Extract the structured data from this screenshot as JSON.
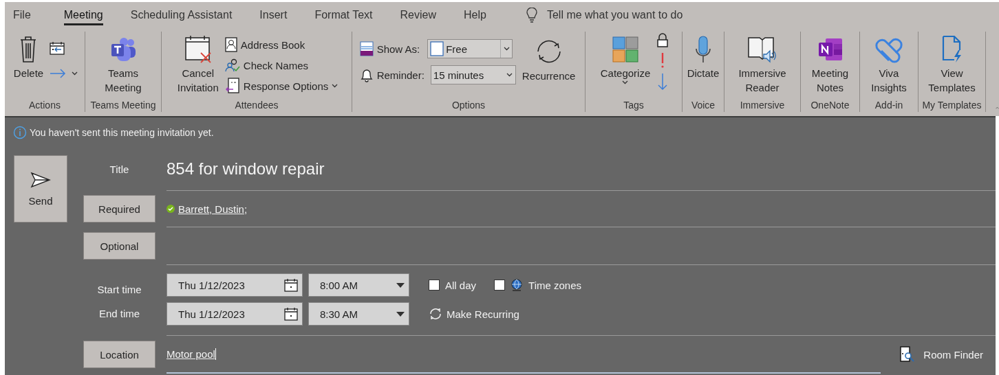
{
  "menu_tabs": [
    {
      "label": "File",
      "selected": false
    },
    {
      "label": "Meeting",
      "selected": true
    },
    {
      "label": "Scheduling Assistant",
      "selected": false
    },
    {
      "label": "Insert",
      "selected": false
    },
    {
      "label": "Format Text",
      "selected": false
    },
    {
      "label": "Review",
      "selected": false
    },
    {
      "label": "Help",
      "selected": false
    }
  ],
  "tell_me": {
    "placeholder": "Tell me what you want to do"
  },
  "ribbon_groups": [
    {
      "label": "Actions",
      "buttons": [
        {
          "label": "Delete"
        }
      ]
    },
    {
      "label": "Teams Meeting",
      "buttons": [
        {
          "label": "Teams Meeting"
        }
      ]
    },
    {
      "label": "Attendees",
      "buttons": [
        {
          "label": "Cancel Invitation"
        },
        {
          "label": "Address Book"
        },
        {
          "label": "Check Names"
        },
        {
          "label": "Response Options"
        }
      ]
    },
    {
      "label": "Options",
      "fields": [
        {
          "label": "Show As:",
          "value": "Free"
        },
        {
          "label": "Reminder:",
          "value": "15 minutes"
        }
      ],
      "buttons": [
        {
          "label": "Recurrence"
        }
      ]
    },
    {
      "label": "Tags",
      "buttons": [
        {
          "label": "Categorize"
        }
      ]
    },
    {
      "label": "Voice",
      "buttons": [
        {
          "label": "Dictate"
        }
      ]
    },
    {
      "label": "Immersive",
      "buttons": [
        {
          "label": "Immersive Reader"
        }
      ]
    },
    {
      "label": "OneNote",
      "buttons": [
        {
          "label": "Meeting Notes"
        }
      ]
    },
    {
      "label": "Add-in",
      "buttons": [
        {
          "label": "Viva Insights"
        }
      ]
    },
    {
      "label": "My Templates",
      "buttons": [
        {
          "label": "View Templates"
        }
      ]
    }
  ],
  "info_bar": {
    "text": "You haven't sent this meeting invitation yet."
  },
  "send_button": {
    "label": "Send"
  },
  "title": {
    "label": "Title",
    "value": "854 for window repair"
  },
  "required": {
    "button": "Required",
    "attendees": [
      {
        "name": "Barrett, Dustin",
        "separator": ";"
      }
    ]
  },
  "optional": {
    "button": "Optional"
  },
  "start": {
    "label": "Start time",
    "date": "Thu 1/12/2023",
    "time": "8:00 AM"
  },
  "end": {
    "label": "End time",
    "date": "Thu 1/12/2023",
    "time": "8:30 AM"
  },
  "all_day": {
    "label": "All day",
    "checked": false
  },
  "time_zones": {
    "label": "Time zones",
    "checked": false
  },
  "make_recurring": {
    "label": "Make Recurring"
  },
  "location": {
    "button": "Location",
    "value": "Motor pool"
  },
  "room_finder": {
    "label": "Room Finder"
  }
}
